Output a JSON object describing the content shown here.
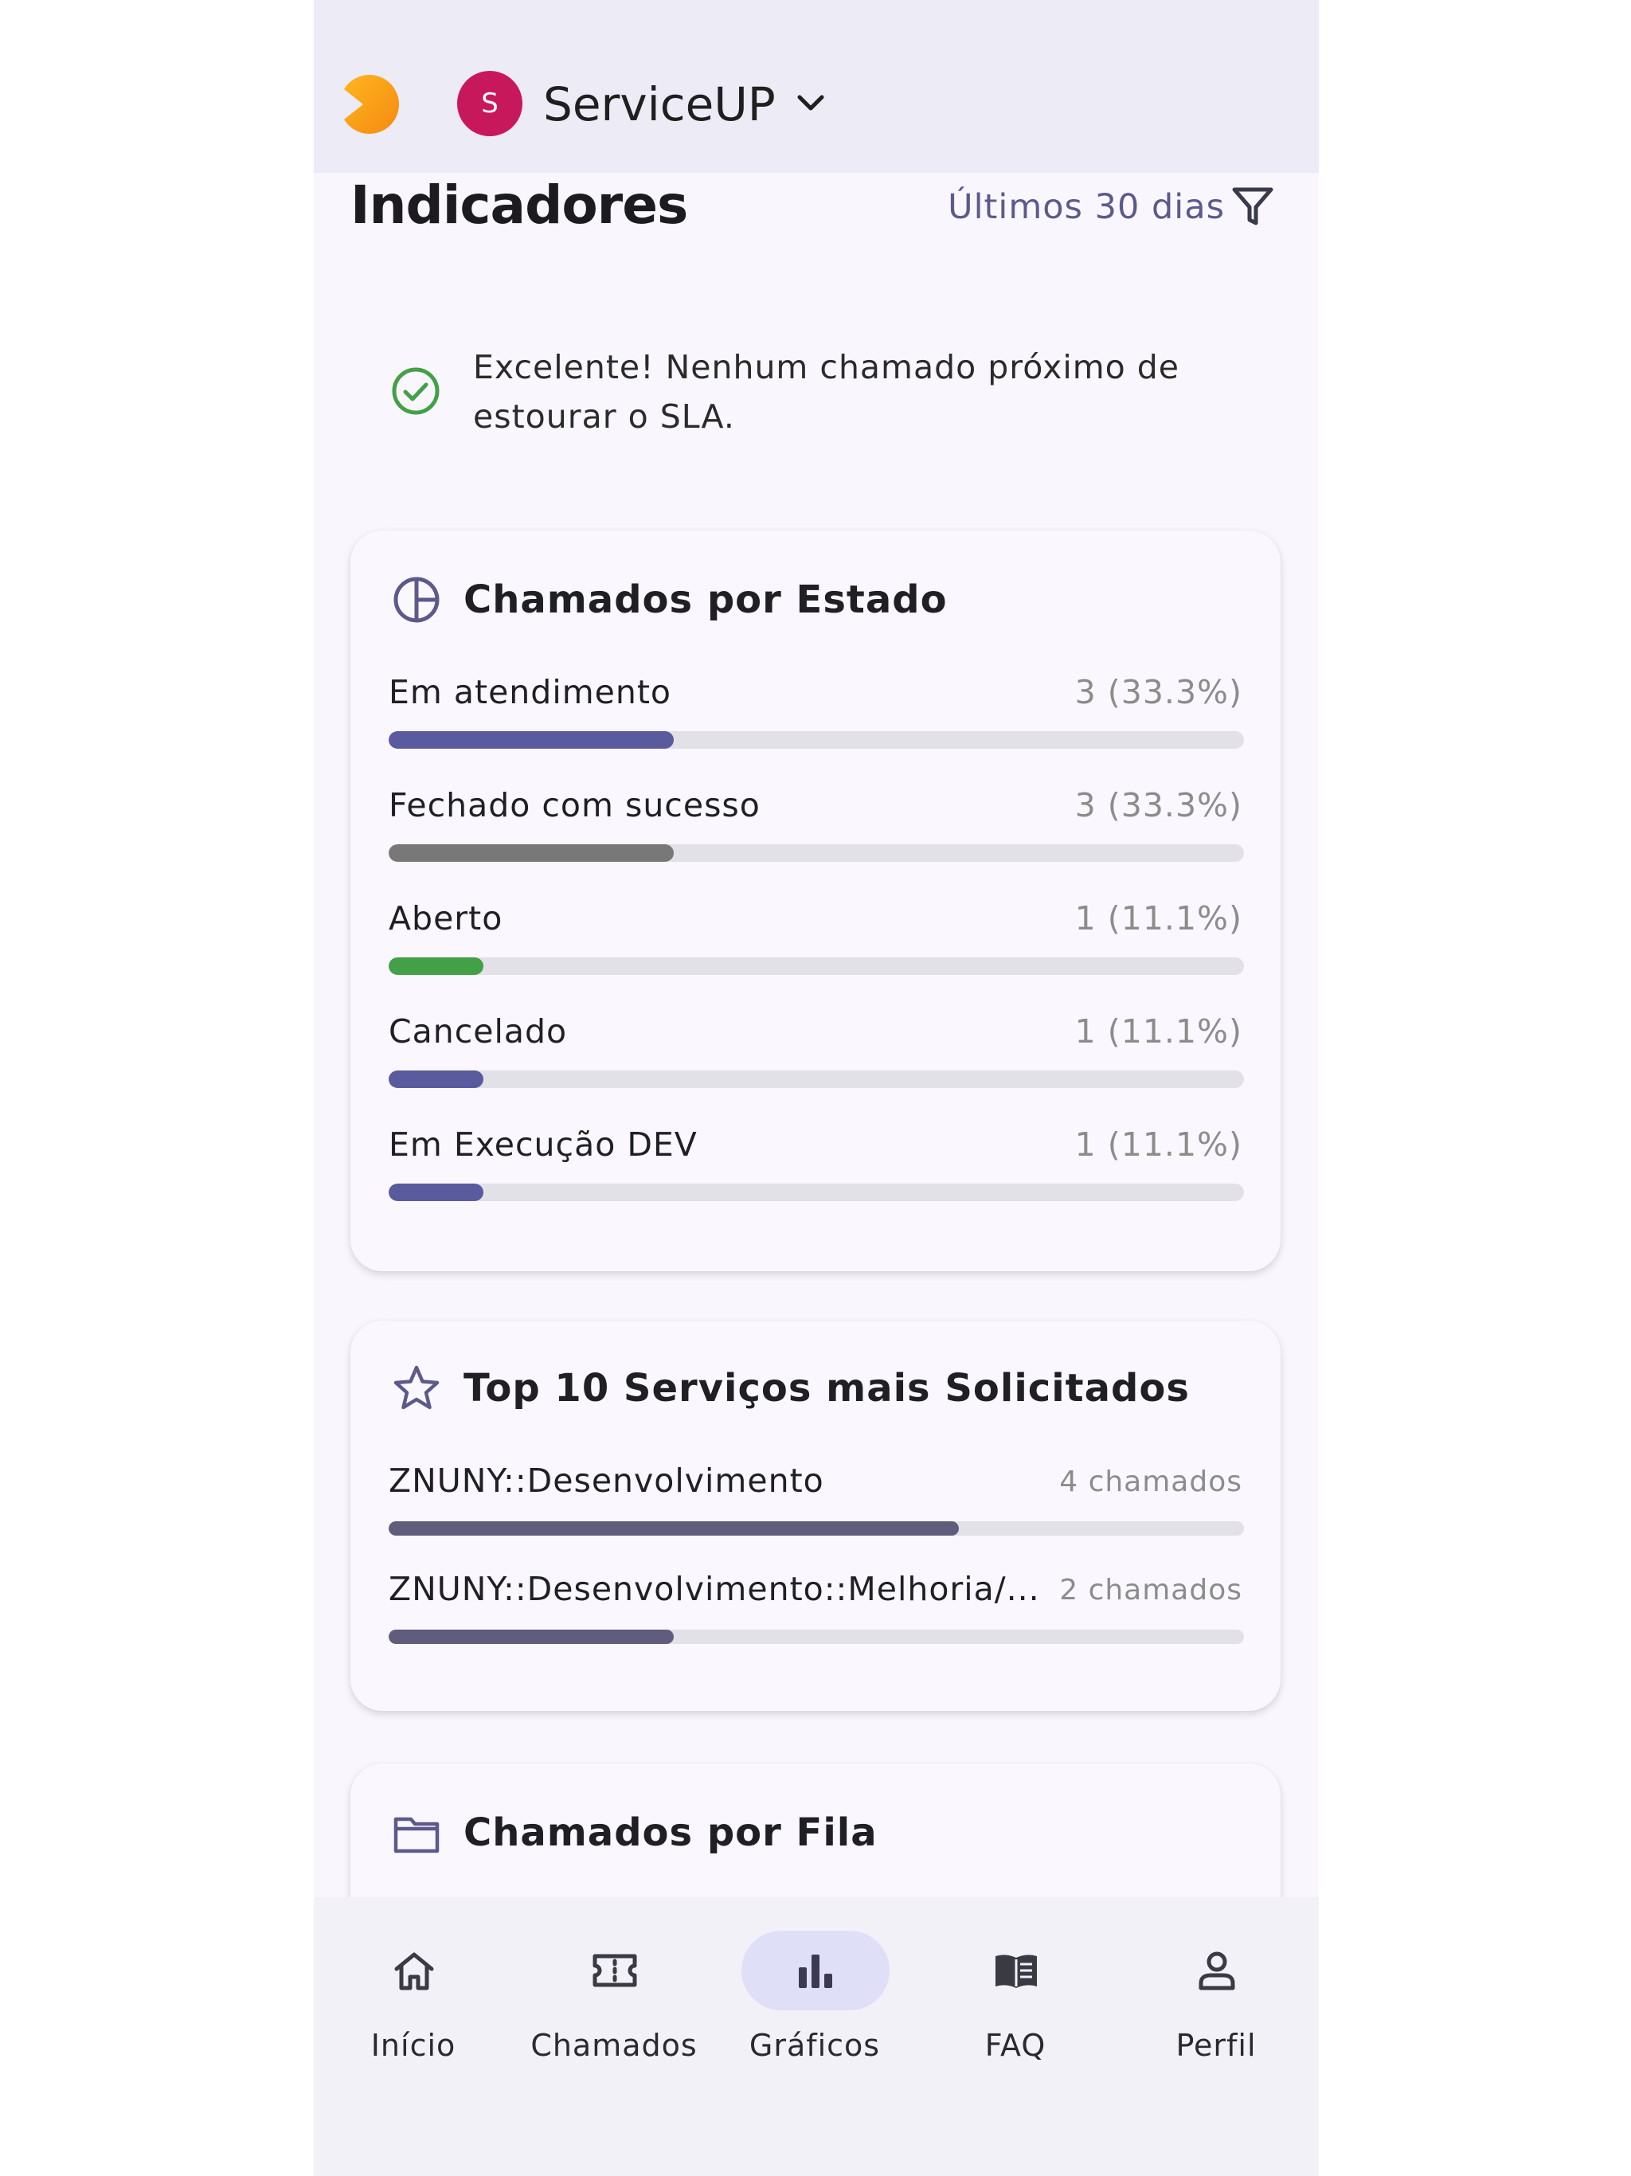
{
  "header": {
    "tenant_initial": "S",
    "tenant_name": "ServiceUP"
  },
  "page": {
    "title": "Indicadores",
    "period_filter": "Últimos 30 dias"
  },
  "sla_banner": {
    "message": "Excelente! Nenhum chamado próximo de estourar o SLA."
  },
  "status_card": {
    "title": "Chamados por Estado",
    "icon": "pie-chart-icon",
    "rows": [
      {
        "label": "Em atendimento",
        "value": "3 (33.3%)",
        "fraction": 0.333,
        "color": "#5a5a9e"
      },
      {
        "label": "Fechado com sucesso",
        "value": "3 (33.3%)",
        "fraction": 0.333,
        "color": "#787878"
      },
      {
        "label": "Aberto",
        "value": "1 (11.1%)",
        "fraction": 0.111,
        "color": "#43a047"
      },
      {
        "label": "Cancelado",
        "value": "1 (11.1%)",
        "fraction": 0.111,
        "color": "#5a5a9e"
      },
      {
        "label": "Em Execução DEV",
        "value": "1 (11.1%)",
        "fraction": 0.111,
        "color": "#5a5a9e"
      }
    ]
  },
  "services_card": {
    "title": "Top 10 Serviços mais Solicitados",
    "icon": "star-icon",
    "rows": [
      {
        "label": "ZNUNY::Desenvolvimento",
        "value": "4 chamados",
        "fraction": 0.667,
        "color": "#5f5c7c"
      },
      {
        "label": "ZNUNY::Desenvolvimento::Melhoria/...",
        "value": "2 chamados",
        "fraction": 0.333,
        "color": "#5f5c7c"
      }
    ]
  },
  "queue_card": {
    "title": "Chamados por Fila",
    "icon": "folder-icon"
  },
  "bottom_nav": {
    "items": [
      {
        "label": "Início",
        "icon": "home-icon",
        "active": false
      },
      {
        "label": "Chamados",
        "icon": "ticket-icon",
        "active": false
      },
      {
        "label": "Gráficos",
        "icon": "bar-chart-icon",
        "active": true
      },
      {
        "label": "FAQ",
        "icon": "book-icon",
        "active": false
      },
      {
        "label": "Perfil",
        "icon": "person-icon",
        "active": false
      }
    ]
  },
  "colors": {
    "accent": "#5c5a8c",
    "success": "#43a047",
    "tenant_avatar": "#c8185c",
    "logo": "#f79b1a"
  }
}
